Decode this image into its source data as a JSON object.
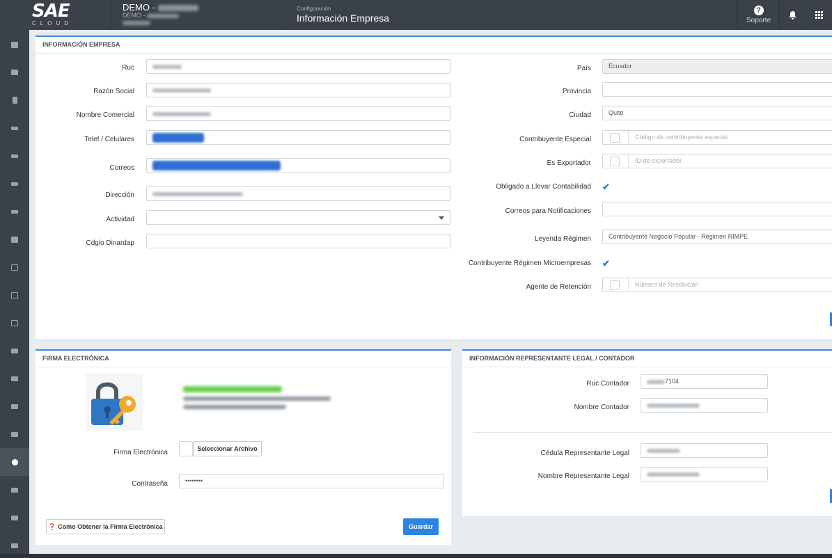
{
  "topbar": {
    "logo": "SAE",
    "logo_sub": "CLOUD",
    "company_name": "DEMO -",
    "company_sub": "DEMO -",
    "breadcrumb": "Configuración",
    "page_title": "Información Empresa",
    "support_label": "Soporte"
  },
  "sidebar": {
    "items": [
      "briefcase-icon",
      "id-card-icon",
      "book-icon",
      "graduation-icon",
      "graduation-icon",
      "graduation-icon",
      "graduation-icon",
      "bank-icon",
      "folder-icon",
      "folder-icon",
      "id-card-icon",
      "users-icon",
      "users-icon",
      "book-icon",
      "book-icon",
      "cogs-icon",
      "cart-icon",
      "folder-icon",
      "folder-icon"
    ],
    "active_index": 15
  },
  "empresa": {
    "title": "INFORMACIÓN EMPRESA",
    "left": {
      "ruc_label": "Ruc",
      "razon_label": "Razón Social",
      "nombre_label": "Nombre Comercial",
      "telef_label": "Telef / Celulares",
      "correos_label": "Correos",
      "direccion_label": "Dirección",
      "actividad_label": "Actividad",
      "dinardap_label": "Cdgio Dinardap"
    },
    "right": {
      "pais_label": "País",
      "pais_value": "Ecuador",
      "provincia_label": "Provincia",
      "ciudad_label": "Ciudad",
      "ciudad_value": "Quito",
      "contrib_label": "Contribuyente Especial",
      "contrib_placeholder": "Código de contribuyente especial",
      "export_label": "Es Exportador",
      "export_placeholder": "ID de exportador",
      "obligado_label": "Obligado a Llevar Contabilidad",
      "notif_label": "Correos para Notificaciones",
      "leyenda_label": "Leyenda Régimen",
      "leyenda_value": "Contribuyente Negocio Popular - Régimen RIMPE",
      "micro_label": "Contribuyente Régimen Microempresas",
      "agente_label": "Agente de Retención",
      "agente_placeholder": "Número de Resolución"
    }
  },
  "firma": {
    "title": "FIRMA ELECTRÓNICA",
    "firma_label": "Firma Electrónica",
    "select_file": "Seleccionar Archivo",
    "password_label": "Contraseña",
    "password_value": "••••••••",
    "help_button": "Como Obtener la Firma Electrónica",
    "save_button": "Guardar"
  },
  "representante": {
    "title": "INFORMACIÓN REPRESENTANTE LEGAL / CONTADOR",
    "ruc_contador_label": "Ruc Contador",
    "ruc_contador_value": "7104",
    "nombre_contador_label": "Nombre Contador",
    "cedula_label": "Cédula Representante Legal",
    "nombre_rep_label": "Nombre Representante Legal"
  },
  "colors": {
    "accent": "#2c84e0",
    "topbar": "#3a4149",
    "check": "#2f7bd5"
  }
}
